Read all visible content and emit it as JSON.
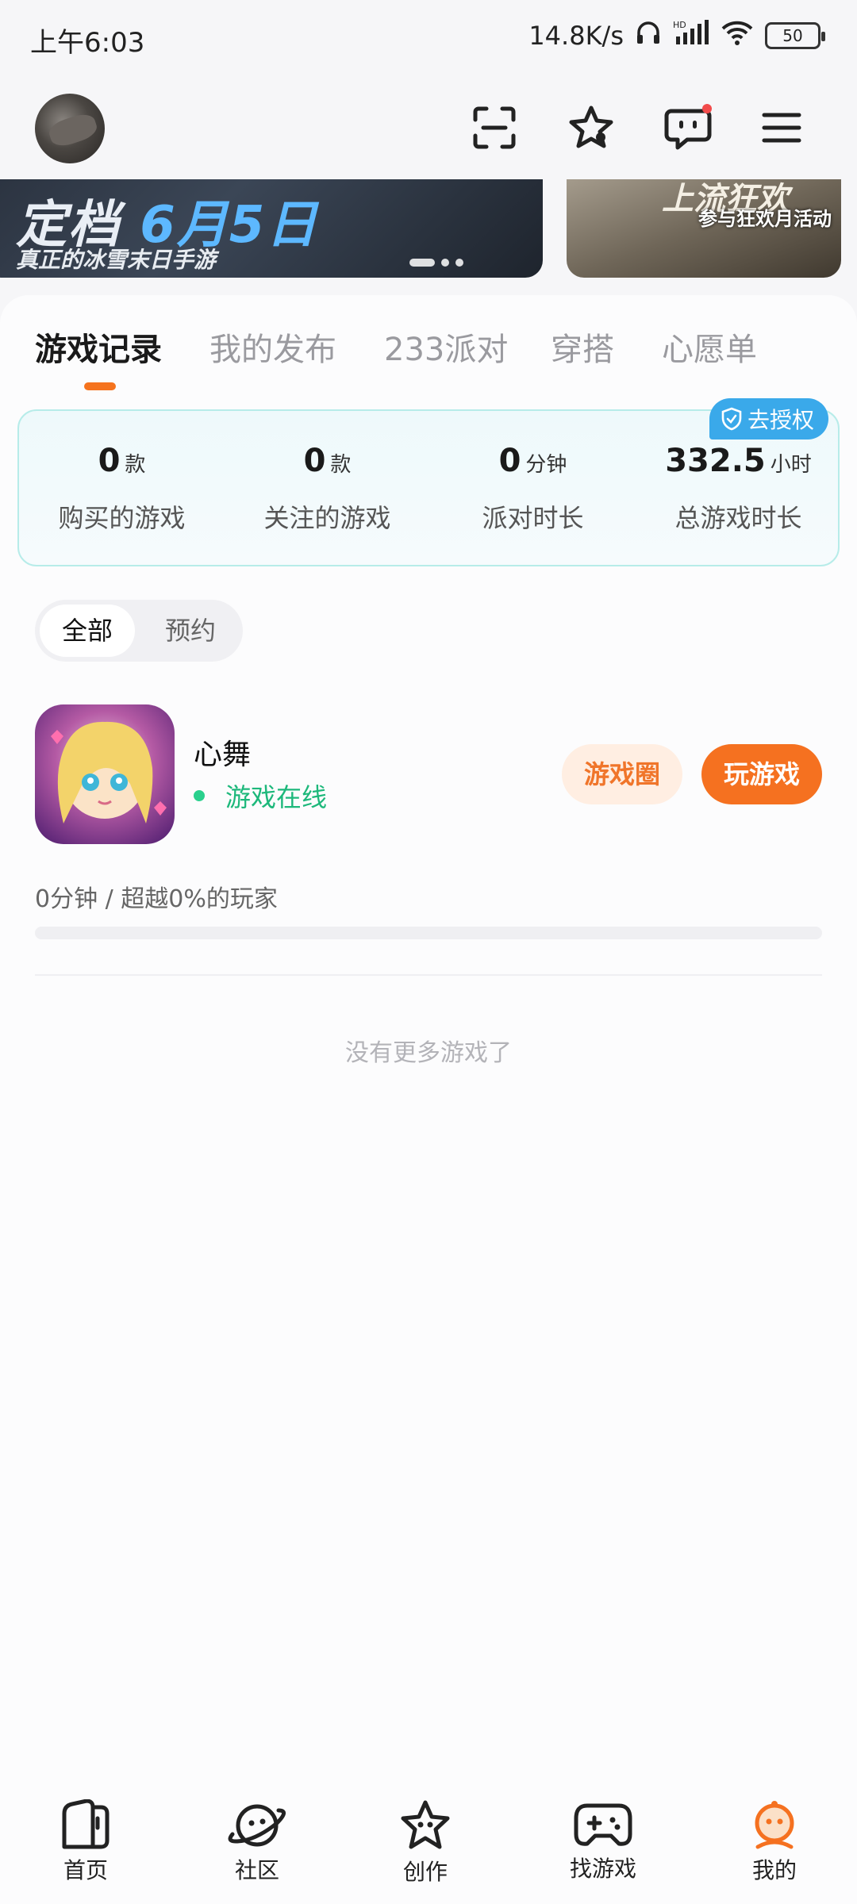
{
  "status_bar": {
    "time": "上午6:03",
    "speed": "14.8K/s",
    "battery": "50"
  },
  "banner": {
    "main_title_a": "定档",
    "main_title_b": "6月5日",
    "main_subtitle": "真正的冰雪末日手游",
    "side_title": "上流狂欢",
    "side_subtitle": "参与狂欢月活动"
  },
  "tabs": [
    {
      "label": "游戏记录",
      "active": true
    },
    {
      "label": "我的发布",
      "active": false
    },
    {
      "label": "233派对",
      "active": false
    },
    {
      "label": "穿搭",
      "active": false
    },
    {
      "label": "心愿单",
      "active": false
    }
  ],
  "auth_badge": "去授权",
  "stats": [
    {
      "value": "0",
      "unit": "款",
      "label": "购买的游戏"
    },
    {
      "value": "0",
      "unit": "款",
      "label": "关注的游戏"
    },
    {
      "value": "0",
      "unit": "分钟",
      "label": "派对时长"
    },
    {
      "value": "332.5",
      "unit": "小时",
      "label": "总游戏时长"
    }
  ],
  "filter": {
    "all": "全部",
    "reserve": "预约"
  },
  "game": {
    "name": "心舞",
    "status": "游戏在线",
    "circle_btn": "游戏圈",
    "play_btn": "玩游戏",
    "playtime": "0分钟 / 超越0%的玩家",
    "progress": 0
  },
  "no_more": "没有更多游戏了",
  "bottom_nav": [
    {
      "label": "首页",
      "icon": "home-icon"
    },
    {
      "label": "社区",
      "icon": "planet-icon"
    },
    {
      "label": "创作",
      "icon": "star-create-icon"
    },
    {
      "label": "找游戏",
      "icon": "gamepad-icon"
    },
    {
      "label": "我的",
      "icon": "profile-icon"
    }
  ],
  "colors": {
    "accent": "#f57120",
    "online": "#1db87b",
    "auth": "#3aa9ea"
  }
}
